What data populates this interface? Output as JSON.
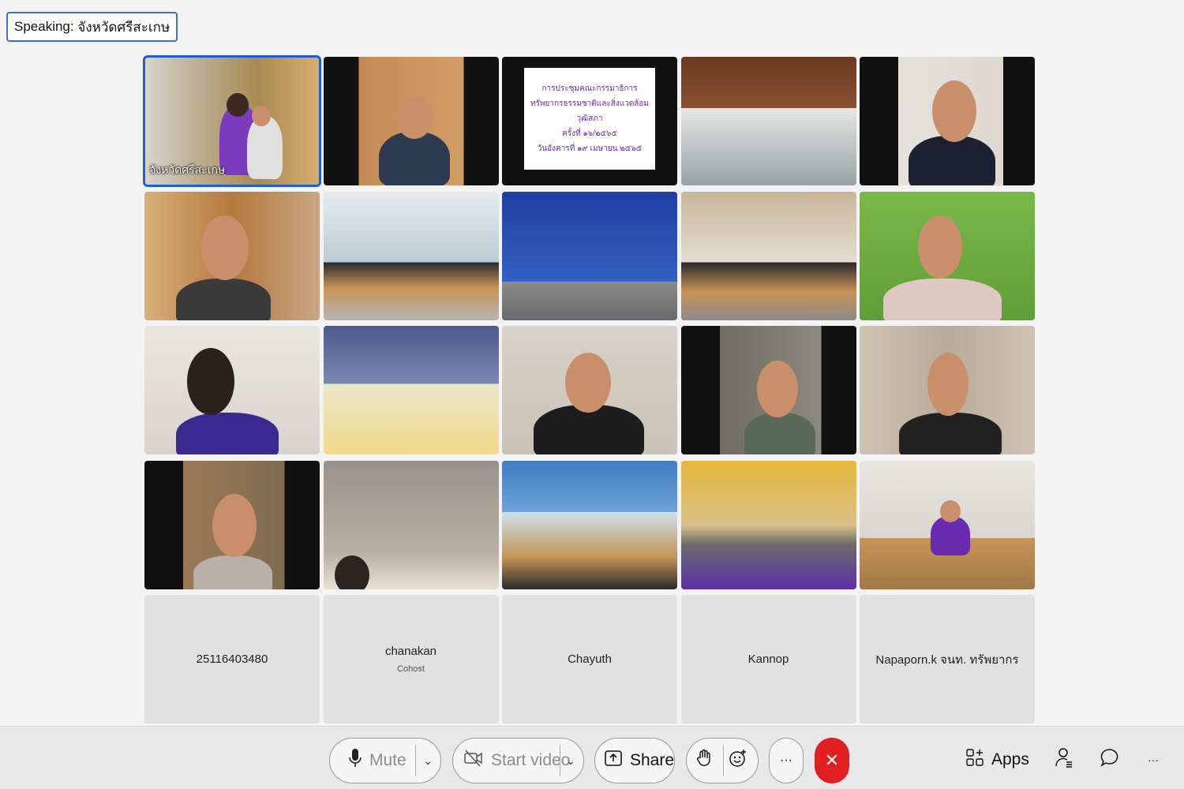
{
  "speaking": {
    "label": "Speaking:",
    "name": "จังหวัดศรีสะเกษ"
  },
  "tiles": [
    {
      "label": "จังหวัดศรีสะเกษ"
    }
  ],
  "slide": {
    "line1": "การประชุมคณะกรรมาธิการ",
    "line2": "ทรัพยากรธรรมชาติและสิ่งแวดล้อม",
    "line3": "วุฒิสภา",
    "line4": "ครั้งที่ ๑๖/๒๕๖๕",
    "line5": "วันอังคารที่ ๑๙ เมษายน ๒๕๖๕"
  },
  "name_tiles": [
    {
      "name": "25116403480",
      "role": ""
    },
    {
      "name": "chanakan",
      "role": "Cohost"
    },
    {
      "name": "Chayuth",
      "role": ""
    },
    {
      "name": "Kannop",
      "role": ""
    },
    {
      "name": "Napaporn.k จนท. ทรัพยากร",
      "role": ""
    }
  ],
  "toolbar": {
    "mute": "Mute",
    "start_video": "Start video",
    "share": "Share",
    "apps": "Apps",
    "more": "···",
    "leave": "✕"
  },
  "icons": [
    "microphone-icon",
    "video-off-icon",
    "share-icon",
    "raise-hand-icon",
    "reactions-icon",
    "more-icon",
    "leave-icon",
    "apps-icon",
    "participants-icon",
    "chat-icon",
    "overflow-icon"
  ]
}
